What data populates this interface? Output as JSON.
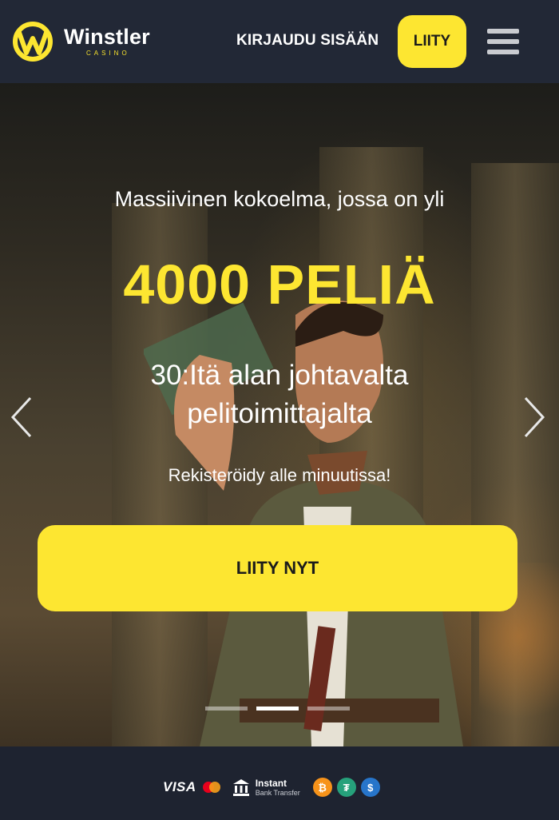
{
  "header": {
    "logo_name": "Winstler",
    "logo_sub": "CASINO",
    "login_label": "KIRJAUDU SISÄÄN",
    "join_label": "LIITY",
    "menu_icon": "hamburger-menu-icon"
  },
  "hero": {
    "tagline": "Massiivinen kokoelma, jossa on yli",
    "headline": "4000 PELIÄ",
    "sub_line1": "30:Itä alan johtavalta",
    "sub_line2": "pelitoimittajalta",
    "register_text": "Rekisteröidy alle minuutissa!",
    "cta_label": "LIITY NYT",
    "prev_icon": "chevron-left-icon",
    "next_icon": "chevron-right-icon",
    "slides_total": 3,
    "active_slide": 2
  },
  "footer": {
    "visa_label": "VISA",
    "bank_line1": "Instant",
    "bank_line2": "Bank Transfer",
    "payment_icons": [
      "visa-icon",
      "mastercard-icon",
      "instant-bank-transfer-icon",
      "bitcoin-icon",
      "tether-icon",
      "usdc-icon"
    ]
  },
  "colors": {
    "accent_yellow": "#fde631",
    "header_bg": "#222836",
    "footer_bg": "#1e2330"
  }
}
